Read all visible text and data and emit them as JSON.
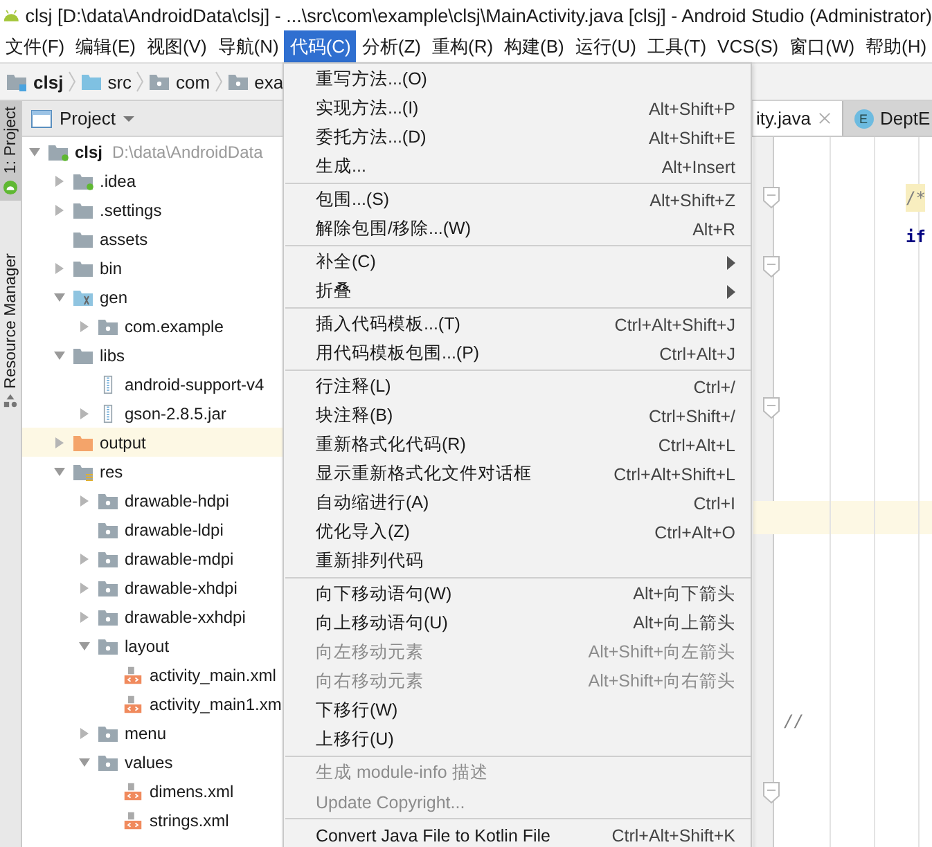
{
  "window": {
    "title": "clsj [D:\\data\\AndroidData\\clsj] - ...\\src\\com\\example\\clsj\\MainActivity.java [clsj] - Android Studio (Administrator)"
  },
  "menubar": [
    {
      "label": "文件(F)",
      "selected": false
    },
    {
      "label": "编辑(E)",
      "selected": false
    },
    {
      "label": "视图(V)",
      "selected": false
    },
    {
      "label": "导航(N)",
      "selected": false
    },
    {
      "label": "代码(C)",
      "selected": true
    },
    {
      "label": "分析(Z)",
      "selected": false
    },
    {
      "label": "重构(R)",
      "selected": false
    },
    {
      "label": "构建(B)",
      "selected": false
    },
    {
      "label": "运行(U)",
      "selected": false
    },
    {
      "label": "工具(T)",
      "selected": false
    },
    {
      "label": "VCS(S)",
      "selected": false
    },
    {
      "label": "窗口(W)",
      "selected": false
    },
    {
      "label": "帮助(H)",
      "selected": false
    }
  ],
  "breadcrumb": [
    {
      "label": "clsj",
      "kind": "module"
    },
    {
      "label": "src",
      "kind": "source"
    },
    {
      "label": "com",
      "kind": "package"
    },
    {
      "label": "exa",
      "kind": "package"
    }
  ],
  "side_strip": [
    {
      "label": "1: Project",
      "kind": "android"
    },
    {
      "label": "Resource Manager",
      "kind": "resource"
    }
  ],
  "project_panel": {
    "title": "Project",
    "tree": [
      {
        "label": "clsj",
        "path": "D:\\data\\AndroidData",
        "kind": "module",
        "expanded": true,
        "selected": false,
        "children": [
          {
            "label": ".idea",
            "kind": "module",
            "expanded": false,
            "selected": false
          },
          {
            "label": ".settings",
            "kind": "folder",
            "expanded": false,
            "selected": false
          },
          {
            "label": "assets",
            "kind": "folder",
            "selected": false
          },
          {
            "label": "bin",
            "kind": "folder",
            "expanded": false,
            "selected": false
          },
          {
            "label": "gen",
            "kind": "gen",
            "expanded": true,
            "selected": false,
            "children": [
              {
                "label": "com.example",
                "kind": "package",
                "expanded": false,
                "selected": false
              }
            ]
          },
          {
            "label": "libs",
            "kind": "folder",
            "expanded": true,
            "selected": false,
            "children": [
              {
                "label": "android-support-v4",
                "kind": "jar",
                "selected": false
              },
              {
                "label": "gson-2.8.5.jar",
                "kind": "jar",
                "expanded": false,
                "selected": false
              }
            ]
          },
          {
            "label": "output",
            "kind": "output",
            "expanded": false,
            "selected": true
          },
          {
            "label": "res",
            "kind": "res",
            "expanded": true,
            "selected": false,
            "children": [
              {
                "label": "drawable-hdpi",
                "kind": "package",
                "expanded": false,
                "selected": false
              },
              {
                "label": "drawable-ldpi",
                "kind": "package",
                "selected": false
              },
              {
                "label": "drawable-mdpi",
                "kind": "package",
                "expanded": false,
                "selected": false
              },
              {
                "label": "drawable-xhdpi",
                "kind": "package",
                "expanded": false,
                "selected": false
              },
              {
                "label": "drawable-xxhdpi",
                "kind": "package",
                "expanded": false,
                "selected": false
              },
              {
                "label": "layout",
                "kind": "package",
                "expanded": true,
                "selected": false,
                "children": [
                  {
                    "label": "activity_main.xml",
                    "kind": "xml",
                    "selected": false
                  },
                  {
                    "label": "activity_main1.xm",
                    "kind": "xml",
                    "selected": false
                  }
                ]
              },
              {
                "label": "menu",
                "kind": "package",
                "expanded": false,
                "selected": false
              },
              {
                "label": "values",
                "kind": "package",
                "expanded": true,
                "selected": false,
                "children": [
                  {
                    "label": "dimens.xml",
                    "kind": "xml",
                    "selected": false
                  },
                  {
                    "label": "strings.xml",
                    "kind": "xml",
                    "selected": false
                  }
                ]
              }
            ]
          }
        ]
      }
    ]
  },
  "editor": {
    "tabs": [
      {
        "label": "ity.java",
        "selected": true
      },
      {
        "label": "DeptE",
        "selected": false,
        "icon": "E"
      }
    ],
    "snippets": [
      {
        "text": "/*",
        "kind": "comment"
      },
      {
        "text": "if",
        "kind": "keyword"
      },
      {
        "text": "//",
        "kind": "line-comment"
      }
    ]
  },
  "code_menu": {
    "groups": [
      [
        {
          "label": "重写方法...(O)"
        },
        {
          "label": "实现方法...(I)",
          "shortcut": "Alt+Shift+P"
        },
        {
          "label": "委托方法...(D)",
          "shortcut": "Alt+Shift+E"
        },
        {
          "label": "生成...",
          "shortcut": "Alt+Insert"
        }
      ],
      [
        {
          "label": "包围...(S)",
          "shortcut": "Alt+Shift+Z"
        },
        {
          "label": "解除包围/移除...(W)",
          "shortcut": "Alt+R"
        }
      ],
      [
        {
          "label": "补全(C)",
          "kind": "submenu"
        },
        {
          "label": "折叠",
          "kind": "submenu"
        }
      ],
      [
        {
          "label": "插入代码模板...(T)",
          "shortcut": "Ctrl+Alt+Shift+J"
        },
        {
          "label": "用代码模板包围...(P)",
          "shortcut": "Ctrl+Alt+J"
        }
      ],
      [
        {
          "label": "行注释(L)",
          "shortcut": "Ctrl+/"
        },
        {
          "label": "块注释(B)",
          "shortcut": "Ctrl+Shift+/"
        },
        {
          "label": "重新格式化代码(R)",
          "shortcut": "Ctrl+Alt+L"
        },
        {
          "label": "显示重新格式化文件对话框",
          "shortcut": "Ctrl+Alt+Shift+L"
        },
        {
          "label": "自动缩进行(A)",
          "shortcut": "Ctrl+I"
        },
        {
          "label": "优化导入(Z)",
          "shortcut": "Ctrl+Alt+O"
        },
        {
          "label": "重新排列代码"
        }
      ],
      [
        {
          "label": "向下移动语句(W)",
          "shortcut": "Alt+向下箭头",
          "disabled": false
        },
        {
          "label": "向上移动语句(U)",
          "shortcut": "Alt+向上箭头",
          "disabled": false
        },
        {
          "label": "向左移动元素",
          "shortcut": "Alt+Shift+向左箭头",
          "disabled": true
        },
        {
          "label": "向右移动元素",
          "shortcut": "Alt+Shift+向右箭头",
          "disabled": true
        },
        {
          "label": "下移行(W)",
          "disabled": false
        },
        {
          "label": "上移行(U)",
          "disabled": false
        }
      ],
      [
        {
          "label": "生成 module-info 描述",
          "disabled": true
        },
        {
          "label": "Update Copyright...",
          "disabled": true
        }
      ],
      [
        {
          "label": "Convert Java File to Kotlin File",
          "shortcut": "Ctrl+Alt+Shift+K"
        }
      ]
    ]
  }
}
